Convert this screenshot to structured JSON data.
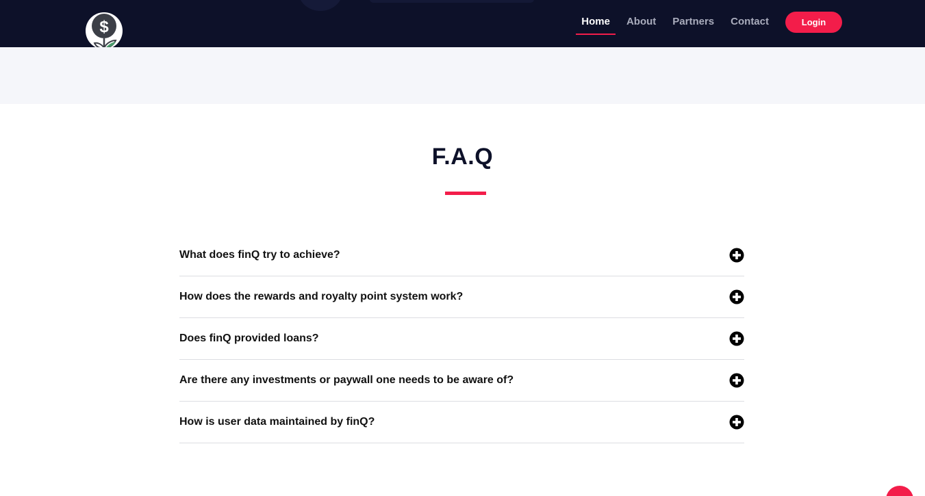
{
  "brand": {
    "logo_icon": "dollar-plant-icon"
  },
  "nav": {
    "items": [
      {
        "label": "Home",
        "active": true
      },
      {
        "label": "About",
        "active": false
      },
      {
        "label": "Partners",
        "active": false
      },
      {
        "label": "Contact",
        "active": false
      }
    ],
    "login_label": "Login"
  },
  "faq": {
    "title": "F.A.Q",
    "items": [
      {
        "question": "What does finQ try to achieve?"
      },
      {
        "question": "How does the rewards and royalty point system work?"
      },
      {
        "question": "Does finQ provided loans?"
      },
      {
        "question": "Are there any investments or paywall one needs to be aware of?"
      },
      {
        "question": "How is user data maintained by finQ?"
      }
    ],
    "toggle_icon": "plus-circle-icon"
  },
  "colors": {
    "navbar": "#0d1129",
    "accent": "#f31d4a",
    "band": "#f5f6fa",
    "title": "#0d1129"
  }
}
